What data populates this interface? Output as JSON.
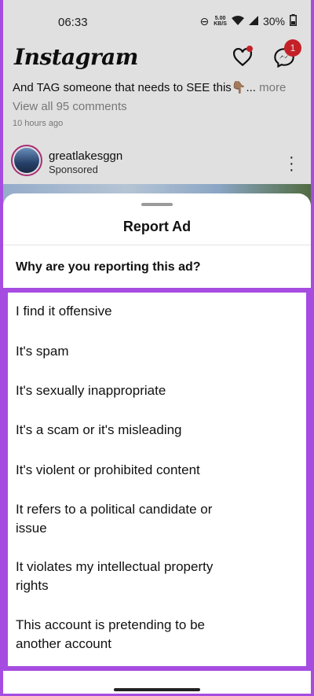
{
  "status_bar": {
    "time": "06:33",
    "net_speed_value": "5.00",
    "net_speed_unit": "KB/S",
    "battery": "30%"
  },
  "topbar": {
    "logo": "Instagram",
    "messenger_badge": "1"
  },
  "feed": {
    "caption_text": "And TAG someone that needs to SEE this👇🏽...",
    "caption_more": "more",
    "comments_link": "View all 95 comments",
    "time_ago": "10 hours ago",
    "post": {
      "username": "greatlakesggn",
      "sponsored_label": "Sponsored"
    }
  },
  "sheet": {
    "title": "Report Ad",
    "question": "Why are you reporting this ad?",
    "options": [
      "I find it offensive",
      "It's spam",
      "It's sexually inappropriate",
      "It's a scam or it's misleading",
      "It's violent or prohibited content",
      "It refers to a political candidate or issue",
      "It violates my intellectual property rights",
      "This account is pretending to be another account"
    ]
  },
  "colors": {
    "highlight": "#a64ce0",
    "notification_red": "#e0262d"
  }
}
